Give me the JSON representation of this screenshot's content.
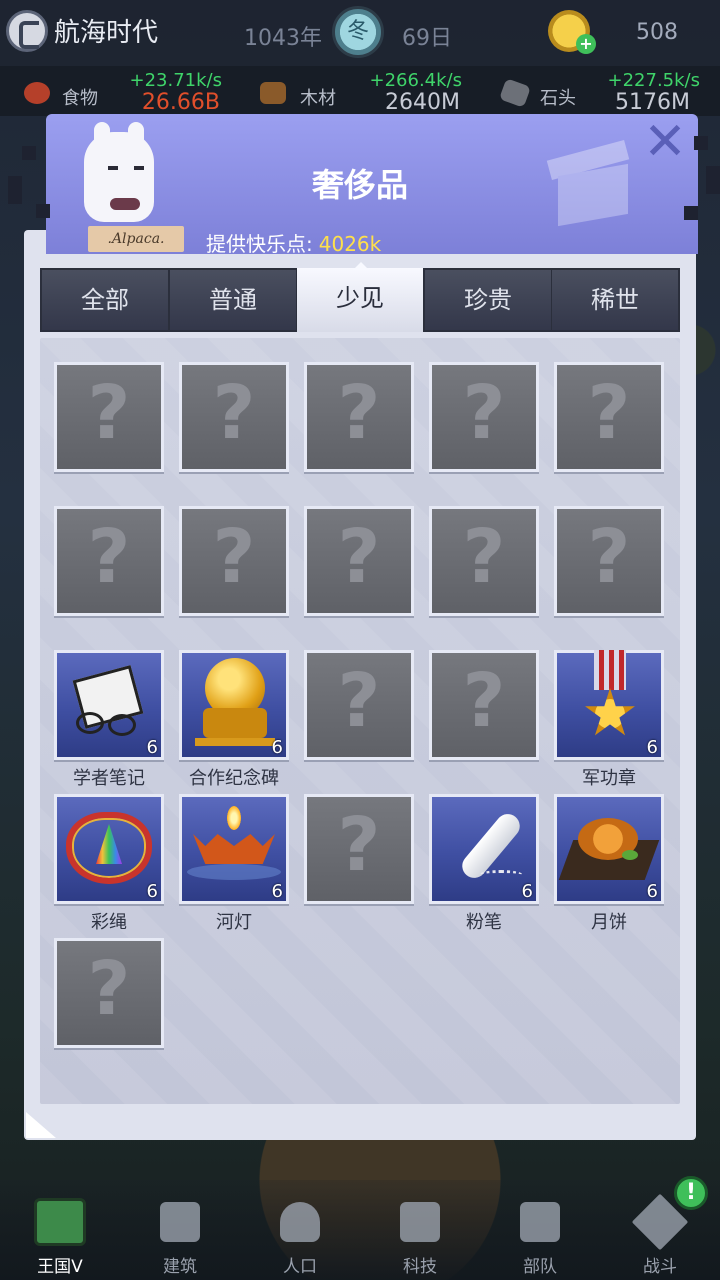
{
  "topbar": {
    "era_name": "航海时代",
    "year": "1043年",
    "season": "冬",
    "day": "69日",
    "gold": "508"
  },
  "resources": [
    {
      "label": "食物",
      "rate": "+23.71k/s",
      "amount": "26.66B",
      "icon": "food-icon"
    },
    {
      "label": "木材",
      "rate": "+266.4k/s",
      "amount": "2640M",
      "icon": "wood-icon"
    },
    {
      "label": "石头",
      "rate": "+227.5k/s",
      "amount": "5176M",
      "icon": "stone-icon"
    }
  ],
  "dialog": {
    "title": "奢侈品",
    "happiness_label": "提供快乐点:",
    "happiness_value": "4026k",
    "sign_text": ".Alpaca.",
    "close_icon": "close-icon"
  },
  "tabs": [
    {
      "label": "全部",
      "active": false
    },
    {
      "label": "普通",
      "active": false
    },
    {
      "label": "少见",
      "active": true
    },
    {
      "label": "珍贵",
      "active": false
    },
    {
      "label": "稀世",
      "active": false
    }
  ],
  "items": [
    {
      "known": false
    },
    {
      "known": false
    },
    {
      "known": false
    },
    {
      "known": false
    },
    {
      "known": false
    },
    {
      "known": false
    },
    {
      "known": false
    },
    {
      "known": false
    },
    {
      "known": false
    },
    {
      "known": false
    },
    {
      "known": true,
      "name": "学者笔记",
      "count": "6",
      "icon": "notebook-icon"
    },
    {
      "known": true,
      "name": "合作纪念碑",
      "count": "6",
      "icon": "monument-icon"
    },
    {
      "known": false
    },
    {
      "known": false
    },
    {
      "known": true,
      "name": "军功章",
      "count": "6",
      "icon": "medal-icon"
    },
    {
      "known": true,
      "name": "彩绳",
      "count": "6",
      "icon": "rope-icon"
    },
    {
      "known": true,
      "name": "河灯",
      "count": "6",
      "icon": "lantern-icon"
    },
    {
      "known": false
    },
    {
      "known": true,
      "name": "粉笔",
      "count": "6",
      "icon": "chalk-icon"
    },
    {
      "known": true,
      "name": "月饼",
      "count": "6",
      "icon": "mooncake-icon"
    },
    {
      "known": false
    }
  ],
  "unknown_mark": "?",
  "nav": [
    {
      "label": "王国V",
      "active": true,
      "icon": "castle-icon"
    },
    {
      "label": "建筑",
      "active": false,
      "icon": "house-icon"
    },
    {
      "label": "人口",
      "active": false,
      "icon": "person-icon"
    },
    {
      "label": "科技",
      "active": false,
      "icon": "book-icon"
    },
    {
      "label": "部队",
      "active": false,
      "icon": "banner-icon"
    },
    {
      "label": "战斗",
      "active": false,
      "icon": "swords-icon"
    }
  ],
  "alert_mark": "!"
}
